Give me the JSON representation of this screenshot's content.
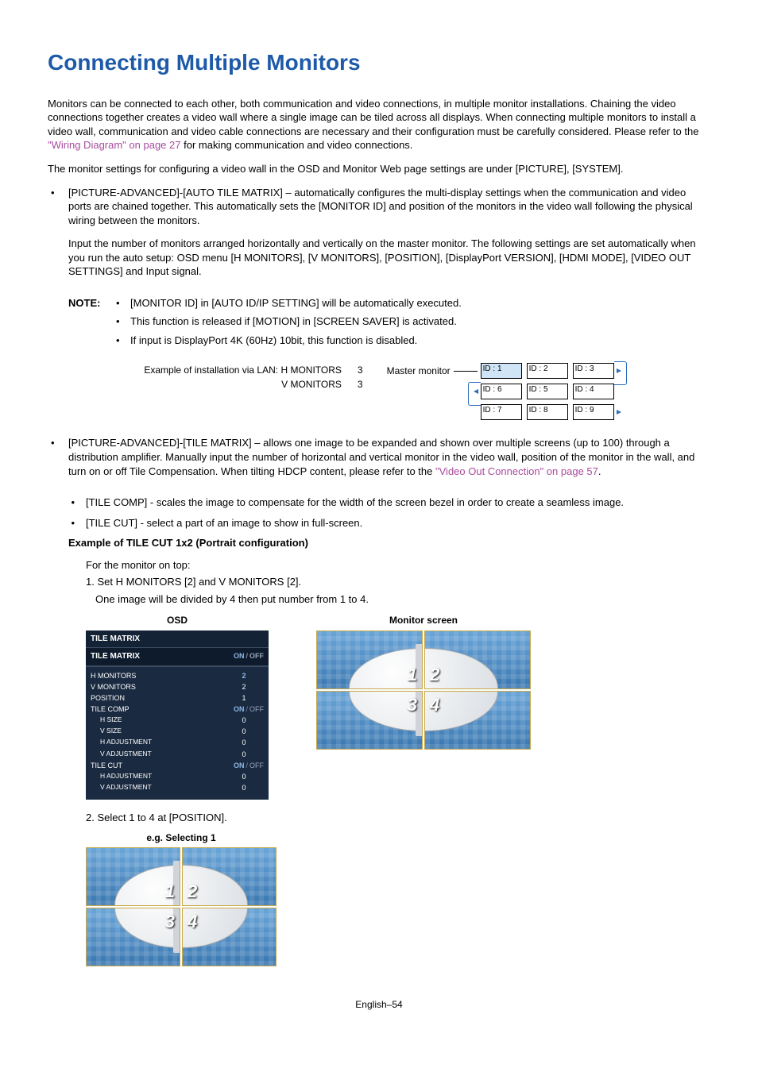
{
  "title": "Connecting Multiple Monitors",
  "intro": "Monitors can be connected to each other, both communication and video connections, in multiple monitor installations. Chaining the video connections together creates a video wall where a single image can be tiled across all displays. When connecting multiple monitors to install a video wall, communication and video cable connections are necessary and their configuration must be carefully considered. Please refer to the ",
  "intro_link": "\"Wiring Diagram\" on page 27",
  "intro_tail": " for making communication and video connections.",
  "osd_line": "The monitor settings for configuring a video wall in the OSD and Monitor Web page settings are under [PICTURE], [SYSTEM].",
  "b1_a": "[PICTURE-ADVANCED]-[AUTO TILE MATRIX] – automatically configures the multi-display settings when the communication and video ports are chained together. This automatically sets the [MONITOR ID] and position of the monitors in the video wall following the physical wiring between the monitors.",
  "b1_b": "Input the number of monitors arranged horizontally and vertically on the master monitor. The following settings are set automatically when you run the auto setup: OSD menu [H MONITORS], [V MONITORS], [POSITION], [DisplayPort VERSION], [HDMI MODE], [VIDEO OUT SETTINGS] and Input signal.",
  "note_label": "NOTE:",
  "note1": "[MONITOR ID] in [AUTO ID/IP SETTING] will be automatically executed.",
  "note2": "This function is released if [MOTION] in [SCREEN SAVER] is activated.",
  "note3": "If input is DisplayPort 4K (60Hz) 10bit, this function is disabled.",
  "install_label": "Example of installation via LAN:",
  "install_h": "H MONITORS",
  "install_hv": "3",
  "install_v": "V MONITORS",
  "install_vv": "3",
  "master_label": "Master monitor",
  "grid": {
    "c1": "ID : 1",
    "c2": "ID : 2",
    "c3": "ID : 3",
    "c4": "ID : 6",
    "c5": "ID : 5",
    "c6": "ID : 4",
    "c7": "ID : 7",
    "c8": "ID : 8",
    "c9": "ID : 9"
  },
  "b2_a": "[PICTURE-ADVANCED]-[TILE MATRIX] – allows one image to be expanded and shown over multiple screens (up to 100) through a distribution amplifier. Manually input the number of horizontal and vertical monitor in the video wall, position of the monitor in the wall, and turn on or off Tile Compensation. When tilting HDCP content, please refer to the ",
  "b2_link": "\"Video Out Connection\" on page 57",
  "b2_tail": ".",
  "sb1": "[TILE COMP] - scales the image to compensate for the width of the screen bezel in order to create a seamless image.",
  "sb2": "[TILE CUT] - select a part of an image to show in full-screen.",
  "ex_heading": "Example of TILE CUT 1x2 (Portrait configuration)",
  "ex_top": "For the monitor on top:",
  "ex_step1": "1. Set H MONITORS [2] and V MONITORS [2].",
  "ex_step1b": "One image will be divided by 4 then put number from 1 to 4.",
  "cap_osd": "OSD",
  "cap_mon": "Monitor screen",
  "osd": {
    "header": "TILE MATRIX",
    "sub": "TILE MATRIX",
    "on": "ON",
    "off": "OFF",
    "slash": "/",
    "rows": {
      "hmon_l": "H MONITORS",
      "hmon_v": "2",
      "vmon_l": "V MONITORS",
      "vmon_v": "2",
      "pos_l": "POSITION",
      "pos_v": "1",
      "tc_l": "TILE COMP",
      "hs_l": "H SIZE",
      "hs_v": "0",
      "vs_l": "V SIZE",
      "vs_v": "0",
      "ha_l": "H ADJUSTMENT",
      "ha_v": "0",
      "va_l": "V ADJUSTMENT",
      "va_v": "0",
      "tcut_l": "TILE CUT",
      "ha2_l": "H ADJUSTMENT",
      "ha2_v": "0",
      "va2_l": "V ADJUSTMENT",
      "va2_v": "0"
    }
  },
  "q": {
    "n1": "1",
    "n2": "2",
    "n3": "3",
    "n4": "4"
  },
  "ex_step2": "2. Select 1 to 4 at [POSITION].",
  "cap_eg": "e.g. Selecting 1",
  "footer": "English–54"
}
